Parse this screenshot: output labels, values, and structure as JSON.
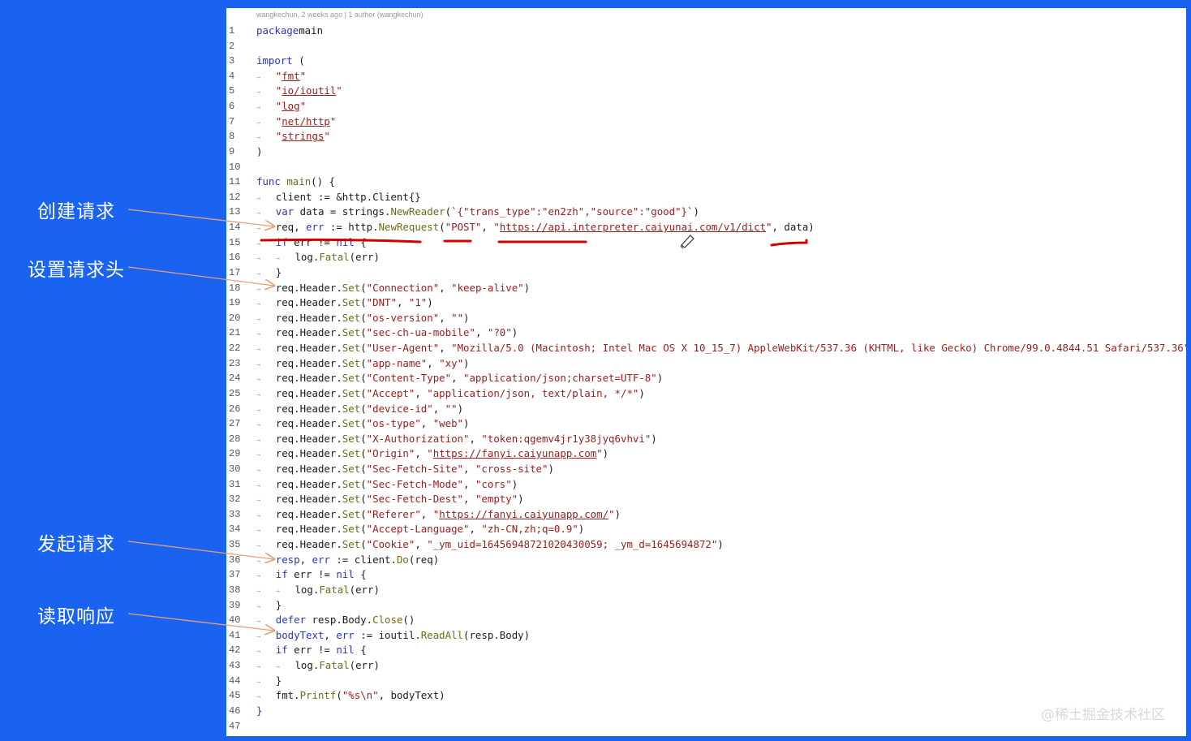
{
  "annotations": {
    "create_request": "创建请求",
    "set_headers": "设置请求头",
    "send_request": "发起请求",
    "read_response": "读取响应"
  },
  "editor": {
    "blame": "wangkechun, 2 weeks ago | 1 author (wangkechun)",
    "lines": [
      {
        "n": "1",
        "t": [
          [
            "kw",
            "package"
          ],
          [
            "",
            "main"
          ]
        ]
      },
      {
        "n": "2",
        "t": []
      },
      {
        "n": "3",
        "t": [
          [
            "kw",
            "import"
          ],
          [
            "",
            " ("
          ]
        ]
      },
      {
        "n": "4",
        "i": 1,
        "t": [
          [
            "str",
            "\""
          ],
          [
            "str url",
            "fmt"
          ],
          [
            "str",
            "\""
          ]
        ]
      },
      {
        "n": "5",
        "i": 1,
        "t": [
          [
            "str",
            "\""
          ],
          [
            "str url",
            "io/ioutil"
          ],
          [
            "str",
            "\""
          ]
        ]
      },
      {
        "n": "6",
        "i": 1,
        "t": [
          [
            "str",
            "\""
          ],
          [
            "str url",
            "log"
          ],
          [
            "str",
            "\""
          ]
        ]
      },
      {
        "n": "7",
        "i": 1,
        "t": [
          [
            "str",
            "\""
          ],
          [
            "str url",
            "net/http"
          ],
          [
            "str",
            "\""
          ]
        ]
      },
      {
        "n": "8",
        "i": 1,
        "t": [
          [
            "str",
            "\""
          ],
          [
            "str url",
            "strings"
          ],
          [
            "str",
            "\""
          ]
        ]
      },
      {
        "n": "9",
        "t": [
          [
            "",
            ")"
          ]
        ]
      },
      {
        "n": "10",
        "t": []
      },
      {
        "n": "11",
        "t": [
          [
            "kw",
            "func "
          ],
          [
            "fn",
            "main"
          ],
          [
            "",
            "() {"
          ]
        ]
      },
      {
        "n": "12",
        "i": 1,
        "t": [
          [
            "",
            "client := &http.Client{}"
          ]
        ]
      },
      {
        "n": "13",
        "i": 1,
        "t": [
          [
            "kw",
            "var"
          ],
          [
            "",
            " data = strings."
          ],
          [
            "fn",
            "NewReader"
          ],
          [
            "",
            "(`"
          ],
          [
            "str",
            "{\"trans_type\":\"en2zh\",\"source\":\"good\"}"
          ],
          [
            "",
            "`)"
          ]
        ]
      },
      {
        "n": "14",
        "i": 1,
        "t": [
          [
            "",
            "req, "
          ],
          [
            "kw",
            "err"
          ],
          [
            "",
            " := http."
          ],
          [
            "fn",
            "NewRequest"
          ],
          [
            "",
            "("
          ],
          [
            "str",
            "\"POST\""
          ],
          [
            "",
            ", "
          ],
          [
            "str",
            "\""
          ],
          [
            "str url",
            "https://api.interpreter.caiyunai.com/v1/dict"
          ],
          [
            "str",
            "\""
          ],
          [
            "",
            ", data)"
          ]
        ]
      },
      {
        "n": "15",
        "i": 1,
        "t": [
          [
            "kw",
            "if"
          ],
          [
            "",
            " err != "
          ],
          [
            "kw",
            "nil"
          ],
          [
            "",
            " {"
          ]
        ]
      },
      {
        "n": "16",
        "i": 2,
        "t": [
          [
            "",
            "log."
          ],
          [
            "fn",
            "Fatal"
          ],
          [
            "",
            "(err)"
          ]
        ]
      },
      {
        "n": "17",
        "i": 1,
        "t": [
          [
            "",
            "}"
          ]
        ]
      },
      {
        "n": "18",
        "i": 1,
        "t": [
          [
            "",
            "req.Header."
          ],
          [
            "fn",
            "Set"
          ],
          [
            "",
            "("
          ],
          [
            "str",
            "\"Connection\""
          ],
          [
            "",
            ", "
          ],
          [
            "str",
            "\"keep-alive\""
          ],
          [
            "",
            ")"
          ]
        ]
      },
      {
        "n": "19",
        "i": 1,
        "t": [
          [
            "",
            "req.Header."
          ],
          [
            "fn",
            "Set"
          ],
          [
            "",
            "("
          ],
          [
            "str",
            "\"DNT\""
          ],
          [
            "",
            ", "
          ],
          [
            "str",
            "\"1\""
          ],
          [
            "",
            ")"
          ]
        ]
      },
      {
        "n": "20",
        "i": 1,
        "t": [
          [
            "",
            "req.Header."
          ],
          [
            "fn",
            "Set"
          ],
          [
            "",
            "("
          ],
          [
            "str",
            "\"os-version\""
          ],
          [
            "",
            ", "
          ],
          [
            "str",
            "\"\""
          ],
          [
            "",
            ")"
          ]
        ]
      },
      {
        "n": "21",
        "i": 1,
        "t": [
          [
            "",
            "req.Header."
          ],
          [
            "fn",
            "Set"
          ],
          [
            "",
            "("
          ],
          [
            "str",
            "\"sec-ch-ua-mobile\""
          ],
          [
            "",
            ", "
          ],
          [
            "str",
            "\"?0\""
          ],
          [
            "",
            ")"
          ]
        ]
      },
      {
        "n": "22",
        "i": 1,
        "t": [
          [
            "",
            "req.Header."
          ],
          [
            "fn",
            "Set"
          ],
          [
            "",
            "("
          ],
          [
            "str",
            "\"User-Agent\""
          ],
          [
            "",
            ", "
          ],
          [
            "str",
            "\"Mozilla/5.0 (Macintosh; Intel Mac OS X 10_15_7) AppleWebKit/537.36 (KHTML, like Gecko) Chrome/99.0.4844.51 Safari/537.36\""
          ],
          [
            "",
            ")"
          ]
        ]
      },
      {
        "n": "23",
        "i": 1,
        "t": [
          [
            "",
            "req.Header."
          ],
          [
            "fn",
            "Set"
          ],
          [
            "",
            "("
          ],
          [
            "str",
            "\"app-name\""
          ],
          [
            "",
            ", "
          ],
          [
            "str",
            "\"xy\""
          ],
          [
            "",
            ")"
          ]
        ]
      },
      {
        "n": "24",
        "i": 1,
        "t": [
          [
            "",
            "req.Header."
          ],
          [
            "fn",
            "Set"
          ],
          [
            "",
            "("
          ],
          [
            "str",
            "\"Content-Type\""
          ],
          [
            "",
            ", "
          ],
          [
            "str",
            "\"application/json;charset=UTF-8\""
          ],
          [
            "",
            ")"
          ]
        ]
      },
      {
        "n": "25",
        "i": 1,
        "t": [
          [
            "",
            "req.Header."
          ],
          [
            "fn",
            "Set"
          ],
          [
            "",
            "("
          ],
          [
            "str",
            "\"Accept\""
          ],
          [
            "",
            ", "
          ],
          [
            "str",
            "\"application/json, text/plain, */*\""
          ],
          [
            "",
            ")"
          ]
        ]
      },
      {
        "n": "26",
        "i": 1,
        "t": [
          [
            "",
            "req.Header."
          ],
          [
            "fn",
            "Set"
          ],
          [
            "",
            "("
          ],
          [
            "str",
            "\"device-id\""
          ],
          [
            "",
            ", "
          ],
          [
            "str",
            "\"\""
          ],
          [
            "",
            ")"
          ]
        ]
      },
      {
        "n": "27",
        "i": 1,
        "t": [
          [
            "",
            "req.Header."
          ],
          [
            "fn",
            "Set"
          ],
          [
            "",
            "("
          ],
          [
            "str",
            "\"os-type\""
          ],
          [
            "",
            ", "
          ],
          [
            "str",
            "\"web\""
          ],
          [
            "",
            ")"
          ]
        ]
      },
      {
        "n": "28",
        "i": 1,
        "t": [
          [
            "",
            "req.Header."
          ],
          [
            "fn",
            "Set"
          ],
          [
            "",
            "("
          ],
          [
            "str",
            "\"X-Authorization\""
          ],
          [
            "",
            ", "
          ],
          [
            "str",
            "\"token:qgemv4jr1y38jyq6vhvi\""
          ],
          [
            "",
            ")"
          ]
        ]
      },
      {
        "n": "29",
        "i": 1,
        "t": [
          [
            "",
            "req.Header."
          ],
          [
            "fn",
            "Set"
          ],
          [
            "",
            "("
          ],
          [
            "str",
            "\"Origin\""
          ],
          [
            "",
            ", "
          ],
          [
            "str",
            "\""
          ],
          [
            "str url",
            "https://fanyi.caiyunapp.com"
          ],
          [
            "str",
            "\""
          ],
          [
            "",
            ")"
          ]
        ]
      },
      {
        "n": "30",
        "i": 1,
        "t": [
          [
            "",
            "req.Header."
          ],
          [
            "fn",
            "Set"
          ],
          [
            "",
            "("
          ],
          [
            "str",
            "\"Sec-Fetch-Site\""
          ],
          [
            "",
            ", "
          ],
          [
            "str",
            "\"cross-site\""
          ],
          [
            "",
            ")"
          ]
        ]
      },
      {
        "n": "31",
        "i": 1,
        "t": [
          [
            "",
            "req.Header."
          ],
          [
            "fn",
            "Set"
          ],
          [
            "",
            "("
          ],
          [
            "str",
            "\"Sec-Fetch-Mode\""
          ],
          [
            "",
            ", "
          ],
          [
            "str",
            "\"cors\""
          ],
          [
            "",
            ")"
          ]
        ]
      },
      {
        "n": "32",
        "i": 1,
        "t": [
          [
            "",
            "req.Header."
          ],
          [
            "fn",
            "Set"
          ],
          [
            "",
            "("
          ],
          [
            "str",
            "\"Sec-Fetch-Dest\""
          ],
          [
            "",
            ", "
          ],
          [
            "str",
            "\"empty\""
          ],
          [
            "",
            ")"
          ]
        ]
      },
      {
        "n": "33",
        "i": 1,
        "t": [
          [
            "",
            "req.Header."
          ],
          [
            "fn",
            "Set"
          ],
          [
            "",
            "("
          ],
          [
            "str",
            "\"Referer\""
          ],
          [
            "",
            ", "
          ],
          [
            "str",
            "\""
          ],
          [
            "str url",
            "https://fanyi.caiyunapp.com/"
          ],
          [
            "str",
            "\""
          ],
          [
            "",
            ")"
          ]
        ]
      },
      {
        "n": "34",
        "i": 1,
        "t": [
          [
            "",
            "req.Header."
          ],
          [
            "fn",
            "Set"
          ],
          [
            "",
            "("
          ],
          [
            "str",
            "\"Accept-Language\""
          ],
          [
            "",
            ", "
          ],
          [
            "str",
            "\"zh-CN,zh;q=0.9\""
          ],
          [
            "",
            ")"
          ]
        ]
      },
      {
        "n": "35",
        "i": 1,
        "t": [
          [
            "",
            "req.Header."
          ],
          [
            "fn",
            "Set"
          ],
          [
            "",
            "("
          ],
          [
            "str",
            "\"Cookie\""
          ],
          [
            "",
            ", "
          ],
          [
            "str",
            "\"_ym_uid=16456948721020430059; _ym_d=1645694872\""
          ],
          [
            "",
            ")"
          ]
        ]
      },
      {
        "n": "36",
        "i": 1,
        "t": [
          [
            "kw",
            "resp"
          ],
          [
            "",
            ", "
          ],
          [
            "kw",
            "err"
          ],
          [
            "",
            " := client."
          ],
          [
            "fn",
            "Do"
          ],
          [
            "",
            "(req)"
          ]
        ]
      },
      {
        "n": "37",
        "i": 1,
        "t": [
          [
            "kw",
            "if"
          ],
          [
            "",
            " err != "
          ],
          [
            "kw",
            "nil"
          ],
          [
            "",
            " {"
          ]
        ]
      },
      {
        "n": "38",
        "i": 2,
        "t": [
          [
            "",
            "log."
          ],
          [
            "fn",
            "Fatal"
          ],
          [
            "",
            "(err)"
          ]
        ]
      },
      {
        "n": "39",
        "i": 1,
        "t": [
          [
            "",
            "}"
          ]
        ]
      },
      {
        "n": "40",
        "i": 1,
        "t": [
          [
            "kw",
            "defer"
          ],
          [
            "",
            " resp.Body."
          ],
          [
            "fn",
            "Close"
          ],
          [
            "",
            "()"
          ]
        ]
      },
      {
        "n": "41",
        "i": 1,
        "t": [
          [
            "kw",
            "bodyText"
          ],
          [
            "",
            ", "
          ],
          [
            "kw",
            "err"
          ],
          [
            "",
            " := ioutil."
          ],
          [
            "fn",
            "ReadAll"
          ],
          [
            "",
            "(resp.Body)"
          ]
        ]
      },
      {
        "n": "42",
        "i": 1,
        "t": [
          [
            "kw",
            "if"
          ],
          [
            "",
            " err != "
          ],
          [
            "kw",
            "nil"
          ],
          [
            "",
            " {"
          ]
        ]
      },
      {
        "n": "43",
        "i": 2,
        "t": [
          [
            "",
            "log."
          ],
          [
            "fn",
            "Fatal"
          ],
          [
            "",
            "(err)"
          ]
        ]
      },
      {
        "n": "44",
        "i": 1,
        "t": [
          [
            "",
            "}"
          ]
        ]
      },
      {
        "n": "45",
        "i": 1,
        "t": [
          [
            "",
            "fmt."
          ],
          [
            "fn",
            "Printf"
          ],
          [
            "",
            "("
          ],
          [
            "str",
            "\"%s\\n\""
          ],
          [
            "",
            ", bodyText)"
          ]
        ]
      },
      {
        "n": "46",
        "t": [
          [
            "kw",
            "}"
          ]
        ]
      },
      {
        "n": "47",
        "t": []
      }
    ]
  },
  "watermark": "@稀土掘金技术社区",
  "colors": {
    "background": "#1a63f0",
    "keyword": "#2c35b8",
    "string": "#9a1c1c",
    "function": "#6f6a1a",
    "marker": "#d40000",
    "arrow": "#e6a07a"
  }
}
